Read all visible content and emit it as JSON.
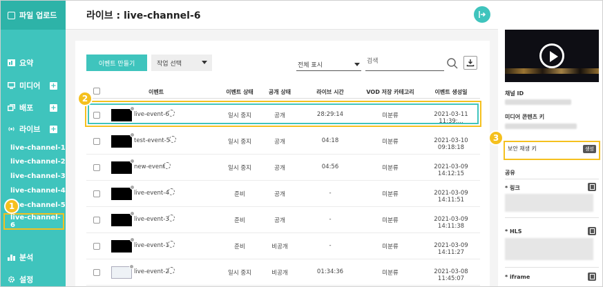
{
  "sidebar": {
    "upload_label": "파일 업로드",
    "items": [
      {
        "label": "요약"
      },
      {
        "label": "미디어"
      },
      {
        "label": "배포"
      },
      {
        "label": "라이브"
      },
      {
        "label": "분석"
      },
      {
        "label": "설정"
      }
    ],
    "channels": [
      "live-channel-1",
      "live-channel-2",
      "live-channel-3",
      "live-channel-4",
      "live-channel-5"
    ],
    "active_channel": "live-channel-6"
  },
  "badges": [
    "1",
    "2",
    "3"
  ],
  "header": {
    "title": "라이브 : live-channel-6"
  },
  "toolbar": {
    "create_label": "이벤트 만들기",
    "action_select": "작업 선택",
    "filter_label": "전체 표시",
    "search_placeholder": "검색"
  },
  "table": {
    "columns": [
      "이벤트",
      "이벤트 상태",
      "공개 상태",
      "라이브 시간",
      "VOD 저장 카테고리",
      "이벤트 생성일"
    ],
    "rows": [
      {
        "name": "live-event-6",
        "status": "일시 중지",
        "visibility": "공개",
        "time": "28:29:14",
        "category": "미분류",
        "created": "2021-03-11 11:39:..."
      },
      {
        "name": "test-event-5",
        "status": "일시 중지",
        "visibility": "공개",
        "time": "04:18",
        "category": "미분류",
        "created": "2021-03-10 09:18:18"
      },
      {
        "name": "new-event",
        "status": "일시 중지",
        "visibility": "공개",
        "time": "04:56",
        "category": "미분류",
        "created": "2021-03-09 14:12:15"
      },
      {
        "name": "live-event-4",
        "status": "준비",
        "visibility": "공개",
        "time": "-",
        "category": "미분류",
        "created": "2021-03-09 14:11:51"
      },
      {
        "name": "live-event-3",
        "status": "준비",
        "visibility": "공개",
        "time": "-",
        "category": "미분류",
        "created": "2021-03-09 14:11:38"
      },
      {
        "name": "live-event-1",
        "status": "준비",
        "visibility": "비공개",
        "time": "-",
        "category": "미분류",
        "created": "2021-03-09 14:11:27"
      },
      {
        "name": "live-event-2",
        "status": "일시 중지",
        "visibility": "비공개",
        "time": "01:34:36",
        "category": "미분류",
        "created": "2021-03-08 11:45:07"
      }
    ]
  },
  "right": {
    "channel_id_label": "채널 ID",
    "media_key_label": "미디어 콘텐츠 키",
    "security_key_label": "보안 재생 키",
    "generate_label": "생성",
    "share_label": "공유",
    "link_label": "* 링크",
    "hls_label": "* HLS",
    "iframe_label": "* iframe"
  },
  "colors": {
    "accent": "#3fc4bd",
    "highlight": "#f5c01e"
  }
}
